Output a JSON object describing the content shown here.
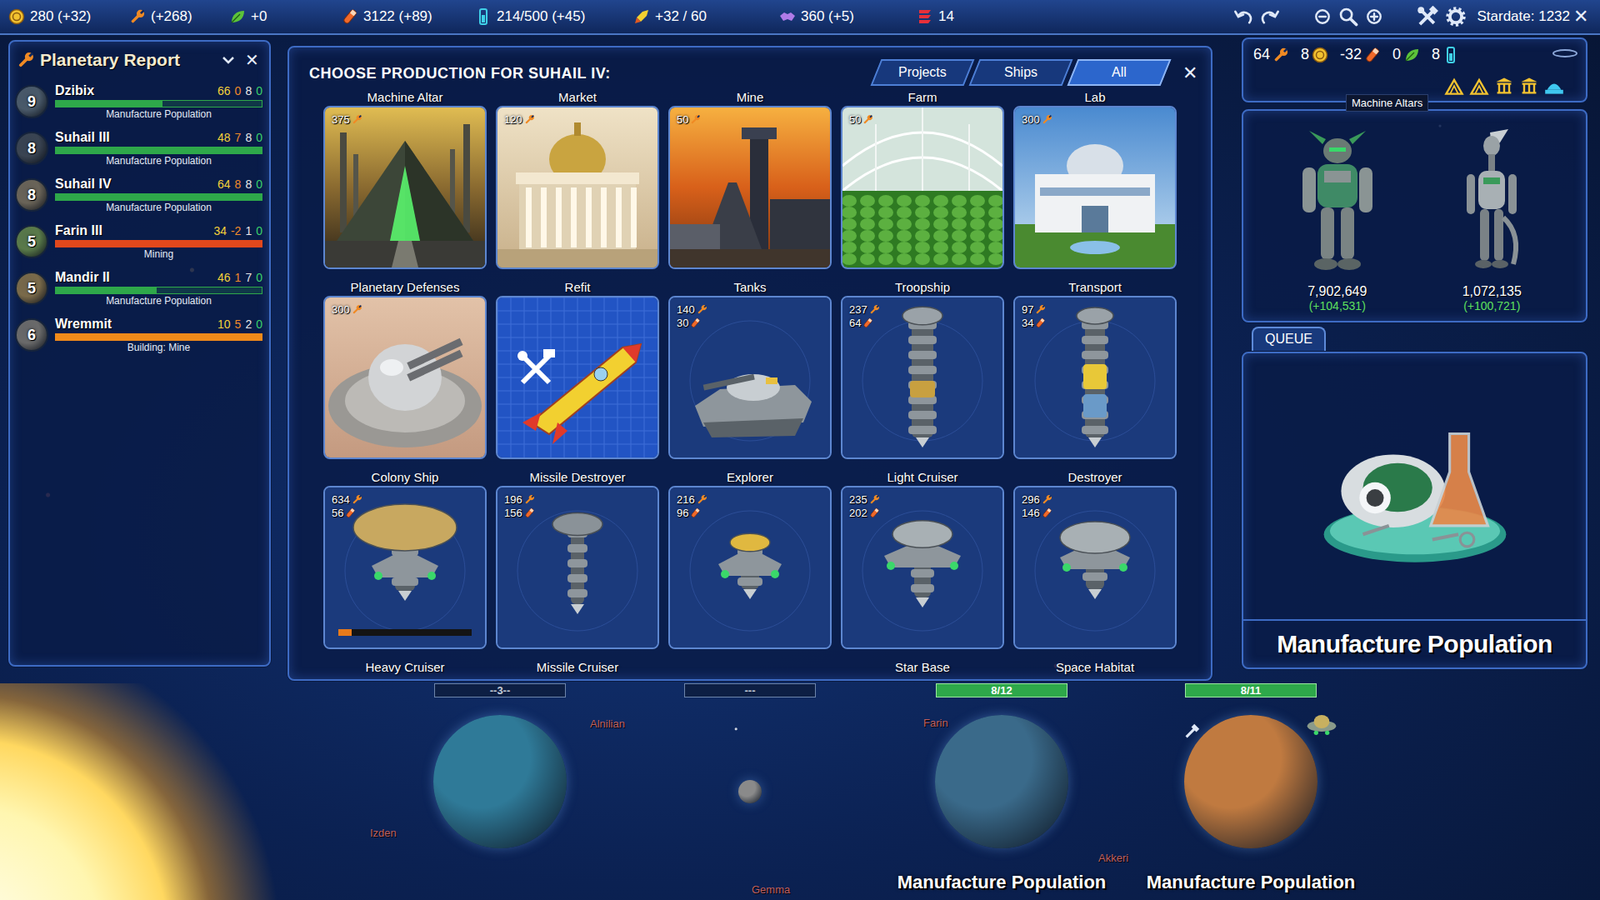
{
  "top_bar": {
    "resources": [
      {
        "kind": "coin",
        "value": "280 (+32)",
        "color": "#f2c230"
      },
      {
        "kind": "production",
        "value": "(+268)",
        "color": "#f08a24"
      },
      {
        "kind": "food",
        "value": "+0",
        "color": "#5cc33a"
      },
      {
        "kind": "research",
        "value": "3122 (+89)",
        "color": "#f0692a"
      },
      {
        "kind": "storage",
        "value": "214/500 (+45)",
        "color": "#3fd0e8"
      },
      {
        "kind": "fleet",
        "value": "+32 / 60",
        "color": "#f2d030"
      },
      {
        "kind": "influence",
        "value": "360 (+5)",
        "color": "#b07be8"
      },
      {
        "kind": "military",
        "value": "14",
        "color": "#e8303a"
      }
    ],
    "stardate": "Stardate: 1232",
    "close": "✕"
  },
  "planetary_report": {
    "title": "Planetary Report",
    "close": "✕",
    "planets": [
      {
        "size": "9",
        "name": "Dzibix",
        "stats": [
          "66",
          "0",
          "8",
          "0"
        ],
        "level": 0.52,
        "color": "#2ea84a",
        "globe_color": "#4a5a6a",
        "task": "Manufacture Population"
      },
      {
        "size": "8",
        "name": "Suhail III",
        "stats": [
          "48",
          "7",
          "8",
          "0"
        ],
        "level": 1,
        "color": "#2ea84a",
        "globe_color": "#3a4452",
        "task": "Manufacture Population"
      },
      {
        "size": "8",
        "name": "Suhail IV",
        "stats": [
          "64",
          "8",
          "8",
          "0"
        ],
        "level": 1,
        "color": "#2ea84a",
        "globe_color": "#6a6458",
        "task": "Manufacture Population"
      },
      {
        "size": "5",
        "name": "Farin III",
        "stats": [
          "34",
          "-2",
          "1",
          "0"
        ],
        "level": 1,
        "color": "#e2481c",
        "globe_color": "#5a7a4a",
        "task": "Mining"
      },
      {
        "size": "5",
        "name": "Mandir II",
        "stats": [
          "46",
          "1",
          "7",
          "0"
        ],
        "level": 0.49,
        "color": "#2ea84a",
        "globe_color": "#7a6a4a",
        "task": "Manufacture Population"
      },
      {
        "size": "6",
        "name": "Wremmit",
        "stats": [
          "10",
          "5",
          "2",
          "0"
        ],
        "level": 1,
        "color": "#f08a1a",
        "globe_color": "#6a6a6a",
        "task": "Building: Mine"
      }
    ]
  },
  "production": {
    "title": "CHOOSE PRODUCTION FOR SUHAIL IV:",
    "close": "✕",
    "tabs": [
      {
        "label": "Projects",
        "selected": false
      },
      {
        "label": "Ships",
        "selected": false
      },
      {
        "label": "All",
        "selected": true
      }
    ],
    "items": [
      {
        "label": "Machine Altar",
        "kind": "building",
        "production": "375"
      },
      {
        "label": "Market",
        "kind": "building",
        "production": "120"
      },
      {
        "label": "Mine",
        "kind": "building",
        "production": "50"
      },
      {
        "label": "Farm",
        "kind": "building",
        "production": "50"
      },
      {
        "label": "Lab",
        "kind": "building",
        "production": "300"
      },
      {
        "label": "Planetary Defenses",
        "kind": "building",
        "production": "300"
      },
      {
        "label": "Refit",
        "kind": "refit"
      },
      {
        "label": "Tanks",
        "kind": "unit",
        "production": "140",
        "research": "30"
      },
      {
        "label": "Troopship",
        "kind": "unit",
        "production": "237",
        "research": "64"
      },
      {
        "label": "Transport",
        "kind": "unit",
        "production": "97",
        "research": "34"
      },
      {
        "label": "Colony Ship",
        "kind": "unit",
        "production": "634",
        "research": "56",
        "level": 0.1
      },
      {
        "label": "Missile Destroyer",
        "kind": "unit",
        "production": "196",
        "research": "156"
      },
      {
        "label": "Explorer",
        "kind": "unit",
        "production": "216",
        "research": "96"
      },
      {
        "label": "Light Cruiser",
        "kind": "unit",
        "production": "235",
        "research": "202"
      },
      {
        "label": "Destroyer",
        "kind": "unit",
        "production": "296",
        "research": "146"
      }
    ],
    "more_labels": [
      "Heavy Cruiser",
      "Missile Cruiser",
      "",
      "Star Base",
      "Space Habitat"
    ]
  },
  "summary": {
    "stats": [
      {
        "kind": "production",
        "value": "64"
      },
      {
        "kind": "coin",
        "value": "8"
      },
      {
        "kind": "research",
        "value": "-32"
      },
      {
        "kind": "food",
        "value": "0"
      },
      {
        "kind": "storage",
        "value": "8"
      }
    ],
    "tooltip": "Machine Altars",
    "populations": [
      {
        "count": "7,902,649",
        "change": "(+104,531)"
      },
      {
        "count": "1,072,135",
        "change": "(+100,721)"
      }
    ],
    "queue_tab": "QUEUE",
    "queue_item": "Manufacture Population"
  },
  "system_view": {
    "orbits": [
      {
        "label": "--3--",
        "owned": false,
        "kind": "planet",
        "color": "#2f7a98"
      },
      {
        "label": "---",
        "owned": false,
        "kind": "moon",
        "color": "#8a8a8a"
      },
      {
        "label": "8/12",
        "owned": true,
        "kind": "planet",
        "color": "#3a6a8a",
        "caption": "Manufacture Population"
      },
      {
        "label": "8/11",
        "owned": true,
        "kind": "planet",
        "color": "#c07a40",
        "caption": "Manufacture Population"
      }
    ],
    "star_labels": [
      "Izden",
      "Alnilian",
      "Farin",
      "Gemma",
      "Akkeri"
    ]
  }
}
